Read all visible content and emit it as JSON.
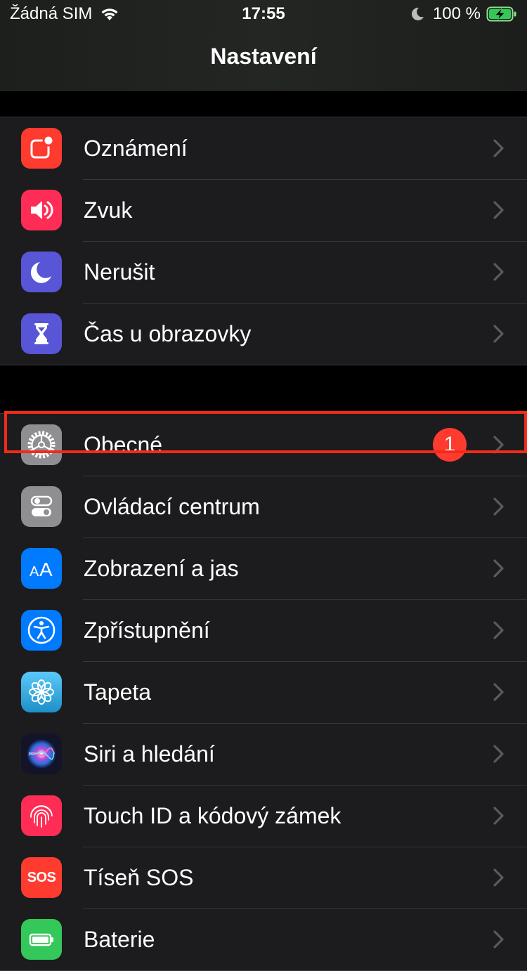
{
  "status_bar": {
    "carrier": "Žádná SIM",
    "time": "17:55",
    "battery": "100 %"
  },
  "nav": {
    "title": "Nastavení"
  },
  "colors": {
    "accent_highlight": "#f22b18",
    "badge": "#ff3b30",
    "group_bg": "#1c1c1e"
  },
  "group1": [
    {
      "label": "Oznámení",
      "icon": "notifications-icon",
      "color": "#ff3b30"
    },
    {
      "label": "Zvuk",
      "icon": "sound-icon",
      "color": "#ff2d55"
    },
    {
      "label": "Nerušit",
      "icon": "moon-icon",
      "color": "#5856d6"
    },
    {
      "label": "Čas u obrazovky",
      "icon": "hourglass-icon",
      "color": "#5856d6"
    }
  ],
  "group2": [
    {
      "label": "Obecné",
      "icon": "gear-icon",
      "color": "#8e8e93",
      "badge": "1"
    },
    {
      "label": "Ovládací centrum",
      "icon": "toggles-icon",
      "color": "#8e8e93"
    },
    {
      "label": "Zobrazení a jas",
      "icon": "text-size-icon",
      "color": "#007aff"
    },
    {
      "label": "Zpřístupnění",
      "icon": "accessibility-icon",
      "color": "#007aff"
    },
    {
      "label": "Tapeta",
      "icon": "flower-icon",
      "color": "#35aadc"
    },
    {
      "label": "Siri a hledání",
      "icon": "siri-icon",
      "color": "#1a1a2e"
    },
    {
      "label": "Touch ID a kódový zámek",
      "icon": "fingerprint-icon",
      "color": "#ff2d55"
    },
    {
      "label": "Tíseň SOS",
      "icon": "sos-icon",
      "color": "#ff3b30",
      "icon_text": "SOS"
    },
    {
      "label": "Baterie",
      "icon": "battery-icon",
      "color": "#34c759"
    }
  ]
}
